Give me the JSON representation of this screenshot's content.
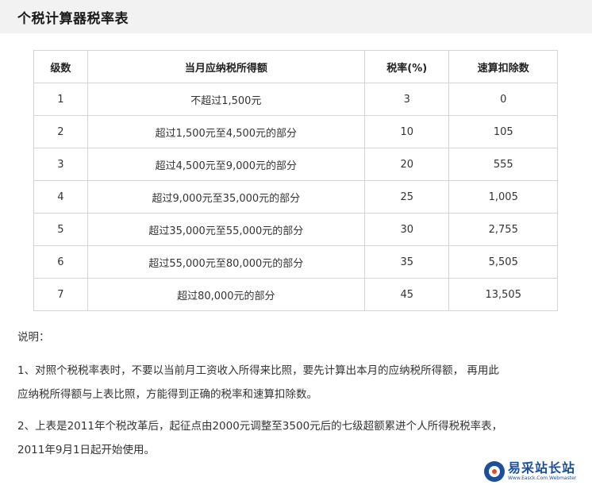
{
  "header": {
    "title": "个税计算器税率表"
  },
  "table": {
    "headers": [
      "级数",
      "当月应纳税所得额",
      "税率(%)",
      "速算扣除数"
    ],
    "rows": [
      [
        "1",
        "不超过1,500元",
        "3",
        "0"
      ],
      [
        "2",
        "超过1,500元至4,500元的部分",
        "10",
        "105"
      ],
      [
        "3",
        "超过4,500元至9,000元的部分",
        "20",
        "555"
      ],
      [
        "4",
        "超过9,000元至35,000元的部分",
        "25",
        "1,005"
      ],
      [
        "5",
        "超过35,000元至55,000元的部分",
        "30",
        "2,755"
      ],
      [
        "6",
        "超过55,000元至80,000元的部分",
        "35",
        "5,505"
      ],
      [
        "7",
        "超过80,000元的部分",
        "45",
        "13,505"
      ]
    ]
  },
  "notes": {
    "label": "说明：",
    "item1_line1": "1、对照个税税率表时，不要以当前月工资收入所得来比照，要先计算出本月的应纳税所得额， 再用此",
    "item1_line2": "应纳税所得额与上表比照，方能得到正确的税率和速算扣除数。",
    "item2_line1": "2、上表是2011年个税改革后，起征点由2000元调整至3500元后的七级超额累进个人所得税税率表，",
    "item2_line2": "2011年9月1日起开始使用。"
  },
  "watermark": {
    "text": "易采站长站",
    "subtext": "Www.Easck.Com Webmaster",
    "logo_color": "#1b4f9b",
    "logo_accent": "#e8452c"
  },
  "colors": {
    "title_bar_bg": "#f2f2f2",
    "table_border": "#d4d4d4",
    "text": "#333333"
  }
}
